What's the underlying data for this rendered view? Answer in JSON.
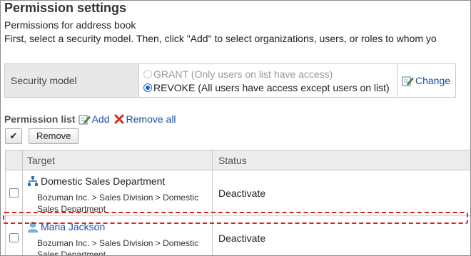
{
  "page": {
    "title": "Permission settings",
    "subtitle": "Permissions for address book",
    "instruction": "First, select a security model. Then, click \"Add\" to select organizations, users, or roles to whom yo"
  },
  "security_model": {
    "label": "Security model",
    "options": [
      {
        "label": "GRANT",
        "note": "(Only users on list have access)",
        "selected": false,
        "disabled": true
      },
      {
        "label": "REVOKE",
        "note": "(All users have access except users on list)",
        "selected": true,
        "disabled": false
      }
    ],
    "change_label": "Change"
  },
  "permission_list": {
    "title": "Permission list",
    "add_label": "Add",
    "remove_all_label": "Remove all",
    "check_all_glyph": "✔",
    "remove_label": "Remove"
  },
  "table": {
    "headers": {
      "target": "Target",
      "status": "Status"
    },
    "rows": [
      {
        "icon": "organization-icon",
        "name": "Domestic Sales Department",
        "is_link": false,
        "path": "Bozuman Inc. > Sales Division > Domestic Sales Department",
        "status": "Deactivate"
      },
      {
        "icon": "user-icon",
        "name": "Maria Jackson",
        "is_link": true,
        "path": "Bozuman Inc. > Sales Division > Domestic Sales Department",
        "status": "Deactivate"
      }
    ]
  },
  "colors": {
    "link": "#1a4fa8",
    "highlight": "#e02020",
    "header_bg": "#e8e8e8"
  }
}
